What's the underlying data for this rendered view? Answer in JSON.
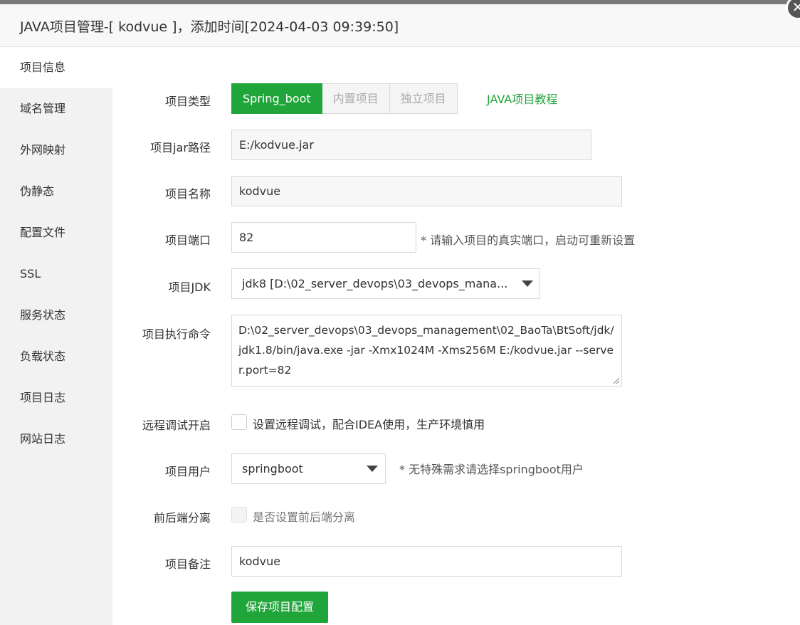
{
  "window": {
    "title": "JAVA项目管理-[ kodvue ]，添加时间[2024-04-03 09:39:50]",
    "close_glyph": "✕"
  },
  "sidebar": {
    "items": [
      {
        "label": "项目信息",
        "active": true
      },
      {
        "label": "域名管理"
      },
      {
        "label": "外网映射"
      },
      {
        "label": "伪静态"
      },
      {
        "label": "配置文件"
      },
      {
        "label": "SSL"
      },
      {
        "label": "服务状态"
      },
      {
        "label": "负载状态"
      },
      {
        "label": "项目日志"
      },
      {
        "label": "网站日志"
      }
    ]
  },
  "form": {
    "type_label": "项目类型",
    "types": [
      "Spring_boot",
      "内置项目",
      "独立项目"
    ],
    "selected_type": "Spring_boot",
    "tutorial_link": "JAVA项目教程",
    "jar_label": "项目jar路径",
    "jar_value": "E:/kodvue.jar",
    "name_label": "项目名称",
    "name_value": "kodvue",
    "port_label": "项目端口",
    "port_value": "82",
    "port_hint": "* 请输入项目的真实端口，启动可重新设置",
    "jdk_label": "项目JDK",
    "jdk_value": "jdk8 [D:\\02_server_devops\\03_devops_mana...",
    "cmd_label": "项目执行命令",
    "cmd_value": "D:\\02_server_devops\\03_devops_management\\02_BaoTa\\BtSoft/jdk/jdk1.8/bin/java.exe -jar -Xmx1024M -Xms256M E:/kodvue.jar --server.port=82",
    "debug_label": "远程调试开启",
    "debug_text": "设置远程调试，配合IDEA使用，生产环境慎用",
    "user_label": "项目用户",
    "user_value": "springboot",
    "user_hint": "* 无特殊需求请选择springboot用户",
    "separate_label": "前后端分离",
    "separate_text": "是否设置前后端分离",
    "remark_label": "项目备注",
    "remark_value": "kodvue",
    "save_label": "保存项目配置"
  },
  "colors": {
    "accent": "#20a53a",
    "sidebar_bg": "#f2f2f2",
    "titlebar_bg": "#f8f8f8"
  }
}
